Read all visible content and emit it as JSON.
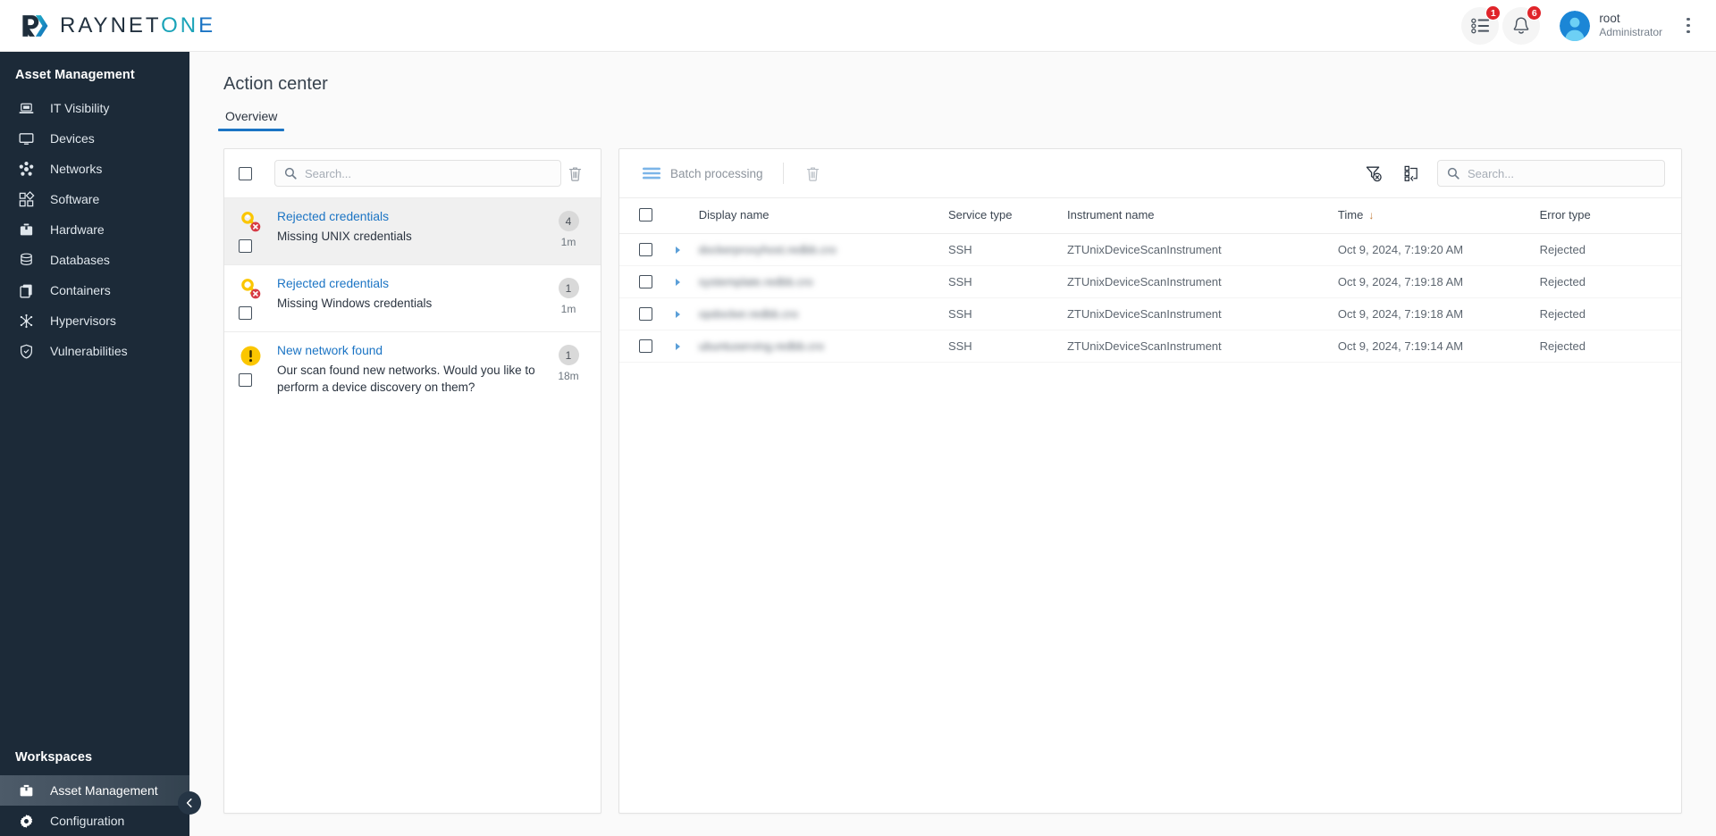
{
  "brand": {
    "name_parts": [
      "RAYNET",
      "ON",
      "E"
    ],
    "logo_icon": "raynet-logo-icon",
    "colors": {
      "dark": "#22313f",
      "teal": "#1aa3b8",
      "blue": "#1b74c4"
    }
  },
  "topbar": {
    "tasks_icon": "task-list-icon",
    "tasks_badge": "1",
    "notifications_icon": "bell-icon",
    "notifications_badge": "6",
    "avatar_icon": "user-avatar-icon",
    "user_name": "root",
    "user_role": "Administrator",
    "overflow_icon": "kebab-menu-icon"
  },
  "sidebar": {
    "section_title": "Asset Management",
    "items": [
      {
        "label": "IT Visibility",
        "icon": "laptop-icon"
      },
      {
        "label": "Devices",
        "icon": "monitor-icon"
      },
      {
        "label": "Networks",
        "icon": "network-nodes-icon"
      },
      {
        "label": "Software",
        "icon": "squares-icon"
      },
      {
        "label": "Hardware",
        "icon": "toolbox-icon"
      },
      {
        "label": "Databases",
        "icon": "database-icon"
      },
      {
        "label": "Containers",
        "icon": "containers-icon"
      },
      {
        "label": "Hypervisors",
        "icon": "hypervisor-icon"
      },
      {
        "label": "Vulnerabilities",
        "icon": "shield-check-icon"
      }
    ],
    "workspaces_title": "Workspaces",
    "workspaces": [
      {
        "label": "Asset Management",
        "icon": "briefcase-icon",
        "active": true
      },
      {
        "label": "Configuration",
        "icon": "gear-icon",
        "active": false
      }
    ],
    "collapse_icon": "chevron-left-icon"
  },
  "main": {
    "page_title": "Action center",
    "tabs": [
      {
        "label": "Overview",
        "active": true
      }
    ]
  },
  "left_panel": {
    "select_all_checkbox": "unchecked",
    "search_placeholder": "Search...",
    "search_value": "",
    "search_icon": "search-icon",
    "delete_icon": "trash-icon",
    "alerts": [
      {
        "icon": "key-error-icon",
        "title": "Rejected credentials",
        "description": "Missing UNIX credentials",
        "count": "4",
        "time": "1m",
        "selected": true
      },
      {
        "icon": "key-error-icon",
        "title": "Rejected credentials",
        "description": "Missing Windows credentials",
        "count": "1",
        "time": "1m",
        "selected": false
      },
      {
        "icon": "warning-icon",
        "title": "New network found",
        "description": "Our scan found new networks. Would you like to perform a device discovery on them?",
        "count": "1",
        "time": "18m",
        "selected": false
      }
    ]
  },
  "right_panel": {
    "batch_label": "Batch processing",
    "batch_icon": "batch-lines-icon",
    "delete_icon": "trash-icon",
    "clear_filter_icon": "filter-clear-icon",
    "columns_icon": "columns-layout-icon",
    "search_placeholder": "Search...",
    "search_value": "",
    "search_icon": "search-icon",
    "columns": [
      "Display name",
      "Service type",
      "Instrument name",
      "Time",
      "Error type"
    ],
    "sort_column": "Time",
    "sort_direction": "desc",
    "sort_icon": "arrow-down-icon",
    "rows": [
      {
        "display_name": "dockerproxyhost.redbb.cro",
        "service_type": "SSH",
        "instrument_name": "ZTUnixDeviceScanInstrument",
        "time": "Oct 9, 2024, 7:19:20 AM",
        "error_type": "Rejected"
      },
      {
        "display_name": "systemplate.redbb.cro",
        "service_type": "SSH",
        "instrument_name": "ZTUnixDeviceScanInstrument",
        "time": "Oct 9, 2024, 7:19:18 AM",
        "error_type": "Rejected"
      },
      {
        "display_name": "opdocker.redbb.cro",
        "service_type": "SSH",
        "instrument_name": "ZTUnixDeviceScanInstrument",
        "time": "Oct 9, 2024, 7:19:18 AM",
        "error_type": "Rejected"
      },
      {
        "display_name": "ubuntuserving.redbb.cro",
        "service_type": "SSH",
        "instrument_name": "ZTUnixDeviceScanInstrument",
        "time": "Oct 9, 2024, 7:19:14 AM",
        "error_type": "Rejected"
      }
    ]
  }
}
